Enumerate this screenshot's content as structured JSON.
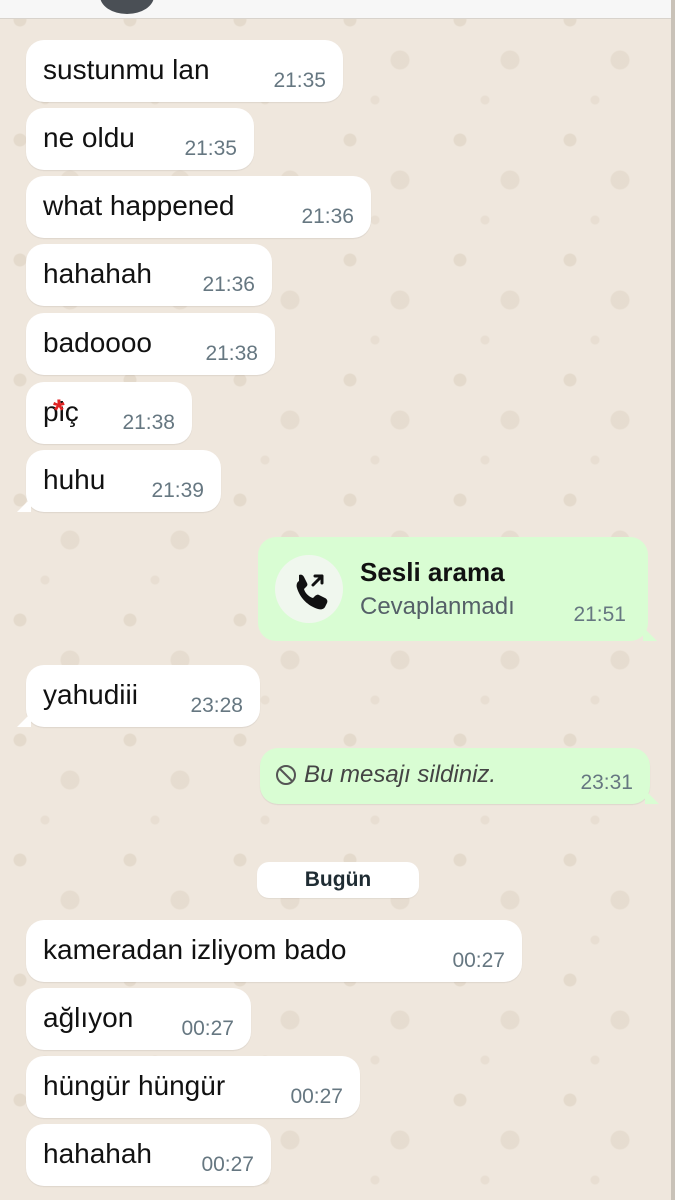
{
  "messages": [
    {
      "text": "sustunmu lan",
      "time": "21:35"
    },
    {
      "text": "ne oldu",
      "time": "21:35"
    },
    {
      "text": "what happened",
      "time": "21:36"
    },
    {
      "text": "hahahah",
      "time": "21:36"
    },
    {
      "text": "badoooo",
      "time": "21:38"
    },
    {
      "text": "piç",
      "time": "21:38"
    },
    {
      "text": "huhu",
      "time": "21:39"
    }
  ],
  "call": {
    "title": "Sesli arama",
    "status": "Cevaplanmadı",
    "time": "21:51"
  },
  "reply": {
    "text": "yahudiii",
    "time": "23:28"
  },
  "deleted": {
    "text": "Bu mesajı sildiniz.",
    "time": "23:31"
  },
  "date_chip": "Bugün",
  "today_messages": [
    {
      "text": "kameradan izliyom bado",
      "time": "00:27"
    },
    {
      "text": "ağlıyon",
      "time": "00:27"
    },
    {
      "text": "hüngür hüngür",
      "time": "00:27"
    },
    {
      "text": "hahahah",
      "time": "00:27"
    }
  ],
  "colors": {
    "incoming": "#ffffff",
    "outgoing": "#d9fdd3",
    "timestamp": "#667781"
  }
}
